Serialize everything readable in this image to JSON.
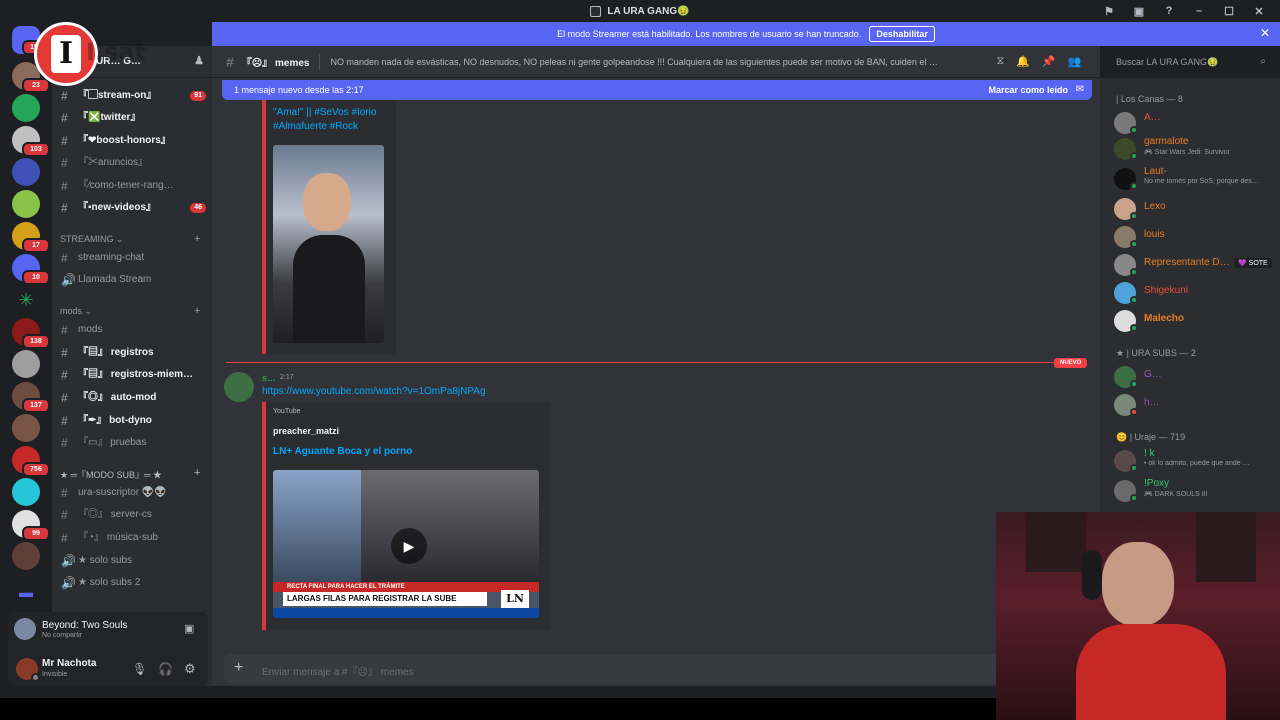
{
  "titlebar": {
    "title": "LA URA GANG🤢"
  },
  "banner": {
    "text": "El modo Streamer está habilitado. Los nombres de usuario se han truncado.",
    "button": "Deshabilitar"
  },
  "servers": {
    "badges": [
      "159",
      "23",
      "103",
      "17",
      "10",
      "138",
      "137",
      "756",
      "99"
    ]
  },
  "guild": {
    "name": "UR… G…",
    "logo_text": "I.sat"
  },
  "channels": [
    {
      "label": "『▢stream-on』",
      "badge": "91"
    },
    {
      "label": "『❎twitter』",
      "badge": ""
    },
    {
      "label": "『❤boost-honors』",
      "badge": ""
    },
    {
      "label": "『✂anuncios』",
      "badge": ""
    },
    {
      "label": "『∕como-tener-rang…",
      "badge": ""
    },
    {
      "label": "『▪new-videos』",
      "badge": "46"
    }
  ],
  "streaming_cat": "STREAMING",
  "streaming_channels": [
    "streaming-chat",
    "Llamada Stream"
  ],
  "mods_cat": "mods",
  "mod_channels": [
    "mods",
    "『▤』 registros",
    "『▤』 registros-miem…",
    "『◎』 auto-mod",
    "『✒』 bot-dyno",
    "『▭』 pruebas"
  ],
  "modosub_cat": "★ ═『MODO SUB』═ ★",
  "sub_channels": [
    "ura-suscriptor 👽👽",
    "『◎』 server-cs",
    "『◔』 música-sub",
    "★ solo subs",
    "★ solo subs 2"
  ],
  "activity": {
    "title": "Beyond: Two Souls",
    "sub": "No compartir"
  },
  "user": {
    "name": "Mr Nachota",
    "status": "Invisible"
  },
  "header": {
    "channel": "『☹』 memes",
    "topic": "NO manden nada de esvásticas, NO desnudos, NO peleas ni gente golpeandose !!! Cualquiera de las siguientes puede ser motivo de BAN, cuiden el stream!",
    "search_placeholder": "Buscar LA URA GANG🤢"
  },
  "newbar": {
    "text": "1 mensaje nuevo desde las 2:17",
    "mark": "Marcar como leído"
  },
  "msg1": {
    "text1": "\"Ama!\" || #SeVos #Iorio",
    "text2": "#Almafuerte #Rock"
  },
  "divider": {
    "label": "NUEVO"
  },
  "msg2": {
    "author": "s…",
    "time": "2:17",
    "link": "https://www.youtube.com/watch?v=1OmPa8jNPAg",
    "provider": "YouTube",
    "channel": "preacher_matzi",
    "title": "LN+ Aguante Boca y el porno",
    "thumb_caption": "LARGAS FILAS PARA REGISTRAR LA SUBE",
    "thumb_top": "RECTA FINAL PARA HACER EL TRÁMITE"
  },
  "input": {
    "placeholder": "Enviar mensaje a #『☹』 memes"
  },
  "member_groups": [
    {
      "title": "| Los Canas — 8",
      "members": [
        {
          "name": "A…",
          "sub": "",
          "color": "#e74c3c"
        },
        {
          "name": "garmalote",
          "sub": "🎮 Star Wars Jedi: Survivor",
          "color": "#e67e22"
        },
        {
          "name": "Laut-",
          "sub": "No me tomés por SoS, porque des…",
          "color": "#e67e22"
        },
        {
          "name": "Lexo",
          "sub": "",
          "color": "#e67e22"
        },
        {
          "name": "louis",
          "sub": "",
          "color": "#e67e22"
        },
        {
          "name": "Representante D…",
          "sub": "",
          "color": "#e67e22"
        },
        {
          "name": "Shigekuni",
          "sub": "",
          "color": "#e74c3c"
        },
        {
          "name": "Malecho",
          "sub": "",
          "color": "#e67e22"
        }
      ]
    },
    {
      "title": "★ | URA SUBS — 2",
      "members": [
        {
          "name": "G…",
          "sub": "",
          "color": "#9b59b6"
        },
        {
          "name": "h…",
          "sub": "",
          "color": "#9b59b6"
        }
      ]
    },
    {
      "title": "😊 | Uraje — 719",
      "members": [
        {
          "name": "! k",
          "sub": "• ok lo admito, puede que ande …",
          "color": "#2ecc71"
        },
        {
          "name": "!Poxy",
          "sub": "🎮 DARK SOULS III",
          "color": "#2ecc71"
        }
      ]
    }
  ],
  "sote_tag": "SOTE",
  "colors": {
    "accent": "#5865f2",
    "new_red": "#f23f43",
    "link": "#00a8fc"
  }
}
